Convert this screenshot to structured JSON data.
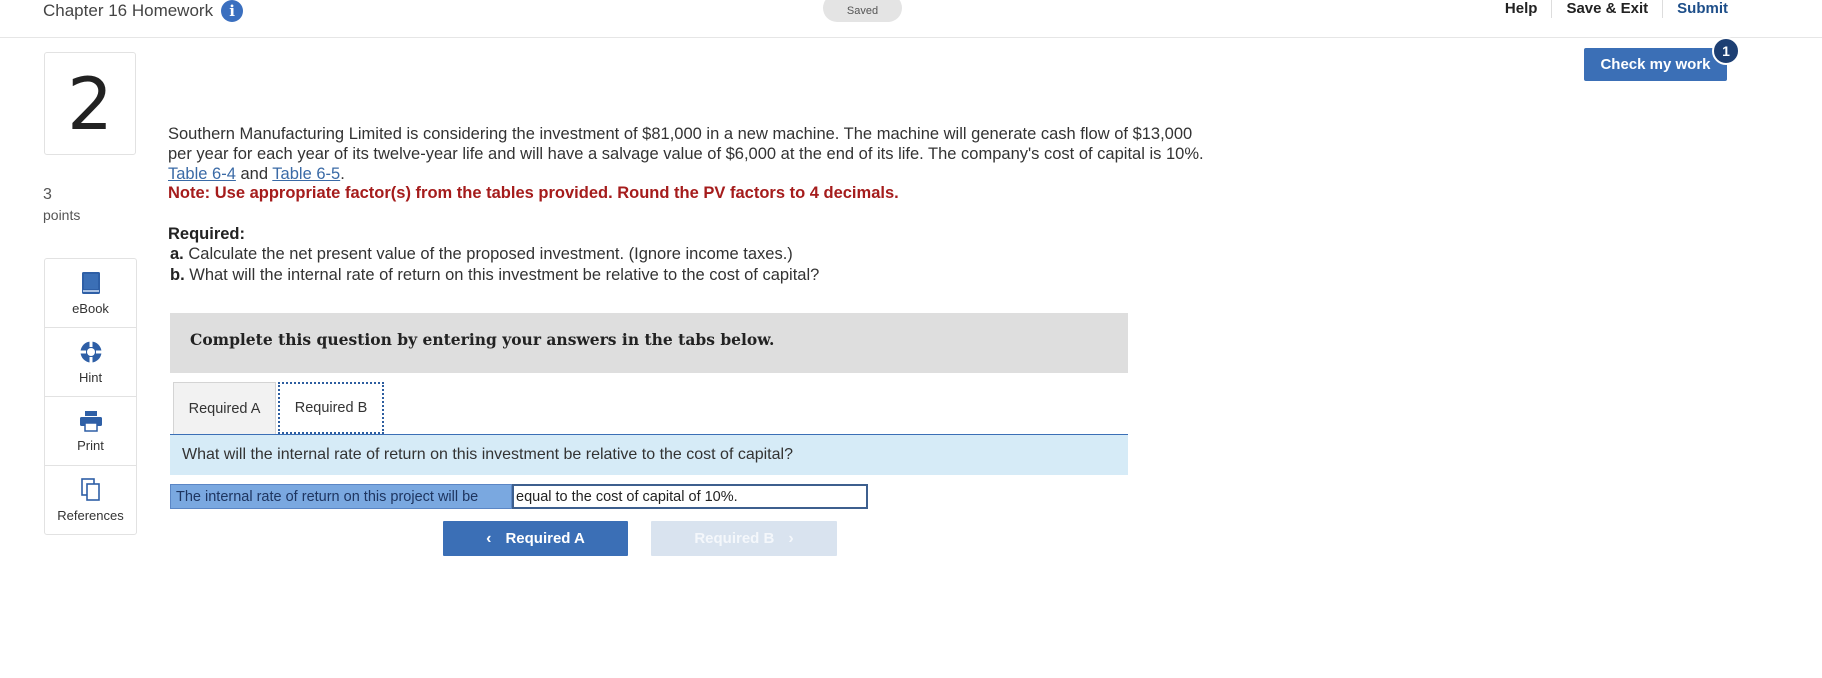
{
  "header": {
    "title": "Chapter 16 Homework",
    "info_icon": "info-icon",
    "status": "Saved",
    "links": [
      "Help",
      "Save & Exit",
      "Submit"
    ]
  },
  "question": {
    "number": "2",
    "points_value": "3",
    "points_label": "points"
  },
  "tools": [
    {
      "label": "eBook",
      "icon": "book-icon"
    },
    {
      "label": "Hint",
      "icon": "lifebuoy-icon"
    },
    {
      "label": "Print",
      "icon": "printer-icon"
    },
    {
      "label": "References",
      "icon": "documents-icon"
    }
  ],
  "check_work": {
    "label": "Check my work",
    "badge": "1"
  },
  "problem": {
    "text_1": "Southern Manufacturing Limited is considering the investment of $81,000 in a new machine. The machine will generate cash flow of $13,000 per year for each year of its twelve-year life and will have a salvage value of $6,000 at the end of its life. The company's cost of capital is 10%. ",
    "link_1": "Table 6-4",
    "and": " and ",
    "link_2": "Table 6-5",
    "period": ".",
    "note": "Note: Use appropriate factor(s) from the tables provided. Round the PV factors to 4 decimals.",
    "required_heading": "Required:",
    "req_a_letter": "a.",
    "req_a_text": " Calculate the net present value of the proposed investment. (Ignore income taxes.)",
    "req_b_letter": "b.",
    "req_b_text": " What will the internal rate of return on this investment be relative to the cost of capital?"
  },
  "instructions": "Complete this question by entering your answers in the tabs below.",
  "tabs": [
    "Required A",
    "Required B"
  ],
  "active_tab": "Required B",
  "tab_question": "What will the internal rate of return on this investment be relative to the cost of capital?",
  "answer": {
    "label": "The internal rate of return on this project will be",
    "value": "equal to the cost of capital of 10%."
  },
  "nav": {
    "prev_label": "Required A",
    "next_label": "Required B"
  },
  "colors": {
    "accent": "#3b6fb6",
    "note_red": "#a51c1c",
    "link_blue": "#3a6aa6"
  }
}
